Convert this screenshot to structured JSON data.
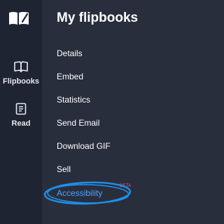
{
  "sidebar": {
    "items": [
      {
        "label": "Flipbooks",
        "icon": "open-book-icon"
      },
      {
        "label": "Read",
        "icon": "document-icon"
      }
    ]
  },
  "panel": {
    "title": "My flipbooks",
    "menu": [
      "Details",
      "Embed",
      "Statistics",
      "Send Email",
      "Download GIF",
      "Sell"
    ],
    "highlight": {
      "label": "Accessibility",
      "badge": "BETA"
    }
  },
  "colors": {
    "rail_bg": "#1f2433",
    "panel_bg": "#292e3d",
    "accent": "#4ea1ff",
    "badge": "#ff5c6c"
  }
}
